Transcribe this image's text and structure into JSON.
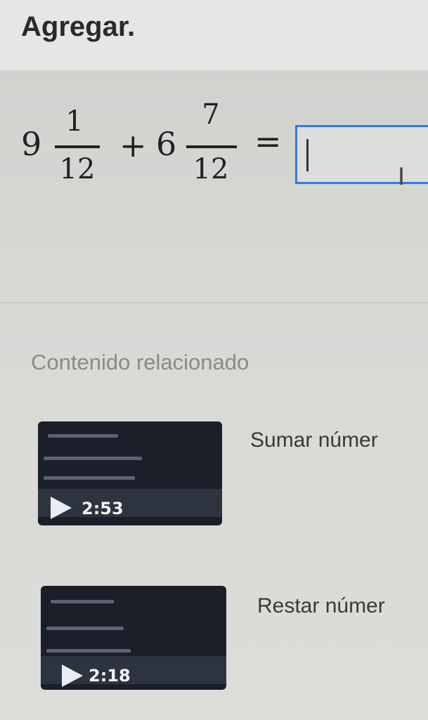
{
  "header": {
    "title": "Agregar."
  },
  "problem": {
    "term1": {
      "whole": "9",
      "numerator": "1",
      "denominator": "12"
    },
    "plus": "+",
    "term2": {
      "whole": "6",
      "numerator": "7",
      "denominator": "12"
    },
    "equals": "=",
    "answer": {
      "value": "",
      "placeholder": ""
    }
  },
  "related": {
    "title": "Contenido relacionado",
    "videos": [
      {
        "title": "Sumar númer",
        "duration": "2:53"
      },
      {
        "title": "Restar númer",
        "duration": "2:18"
      }
    ]
  },
  "colors": {
    "accent": "#2b7de9",
    "thumbnail": "#1a1f29"
  }
}
